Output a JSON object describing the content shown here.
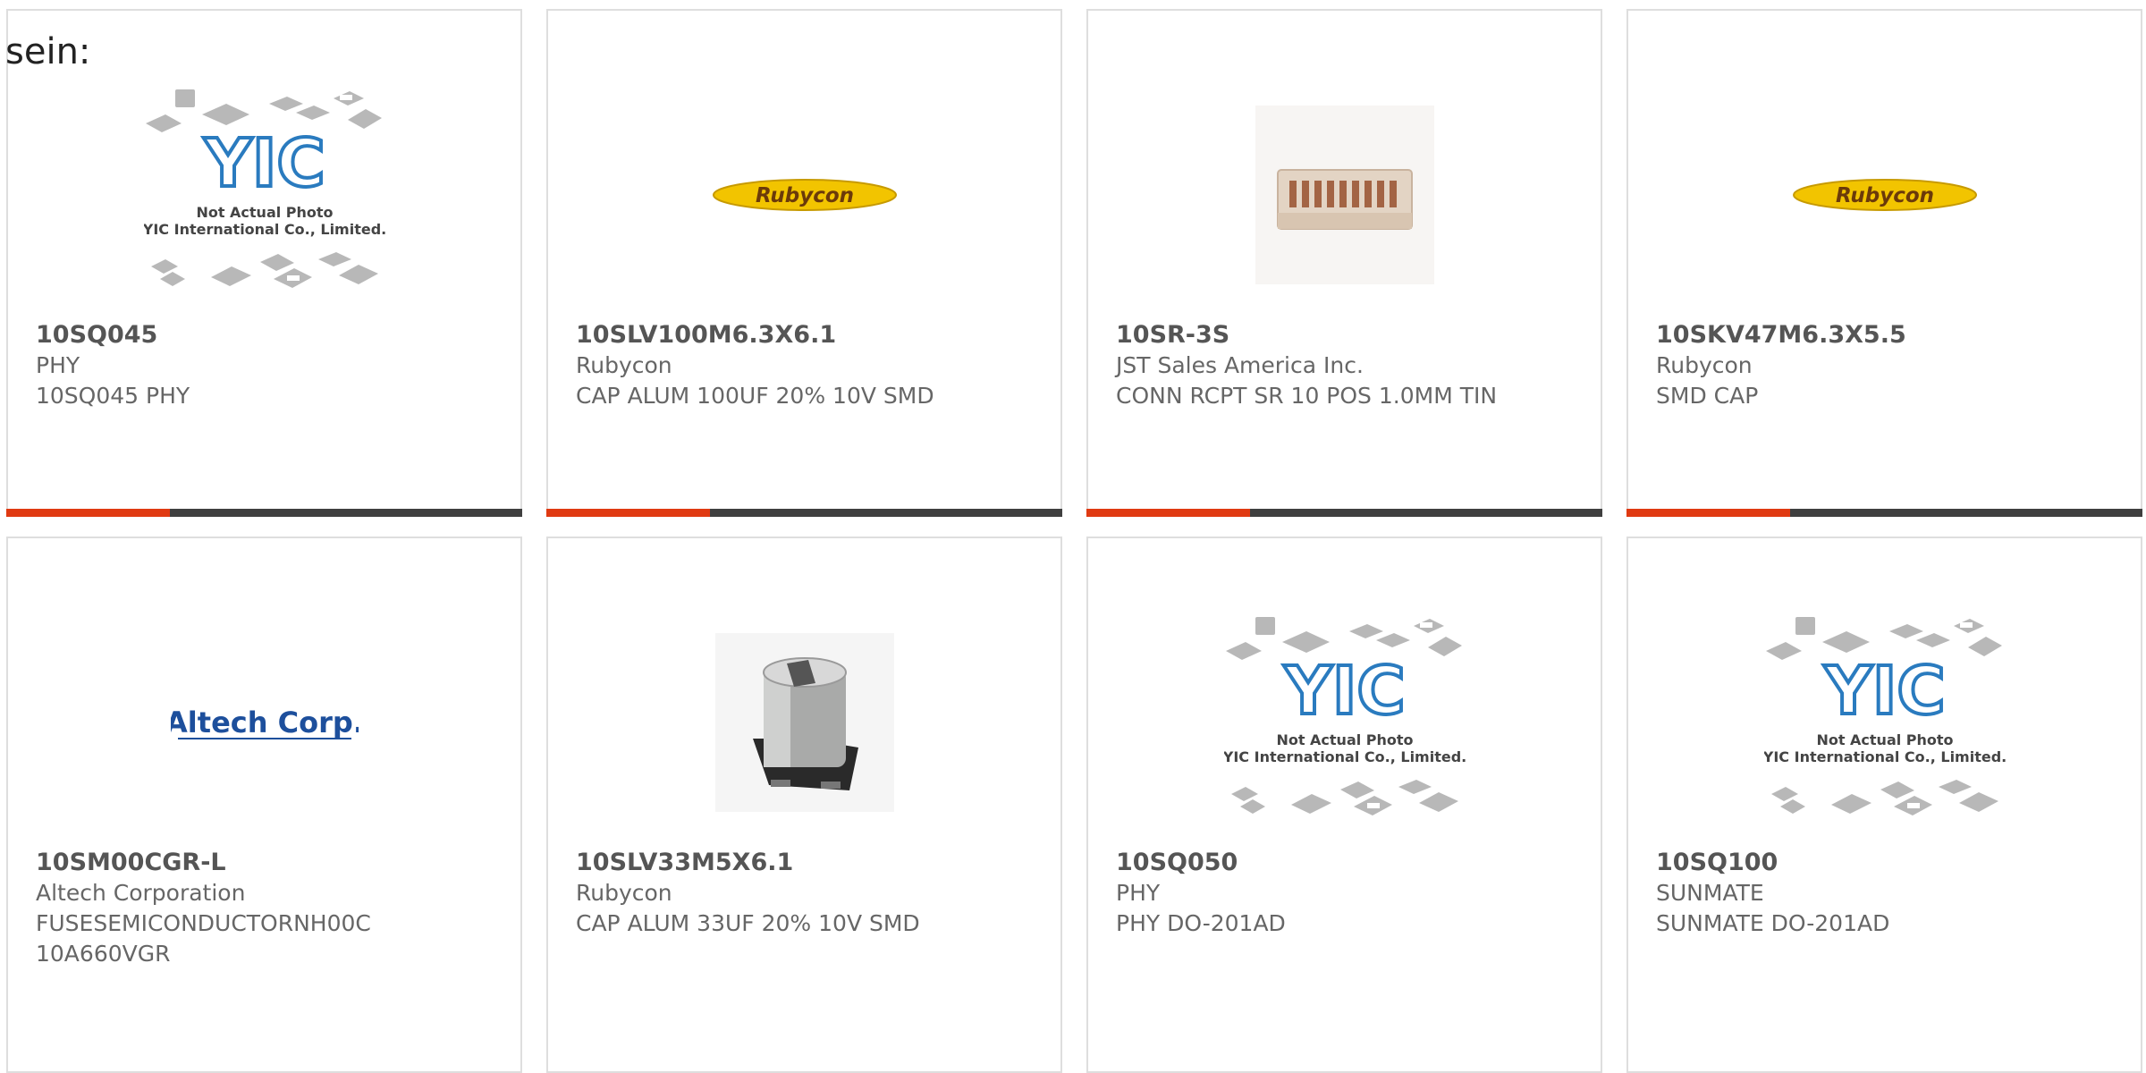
{
  "intro_text": "sein:",
  "products": [
    {
      "part": "10SQ045",
      "manufacturer": "PHY",
      "description": "10SQ045 PHY",
      "image": "yic-placeholder"
    },
    {
      "part": "10SLV100M6.3X6.1",
      "manufacturer": "Rubycon",
      "description": "CAP ALUM 100UF 20% 10V SMD",
      "image": "rubycon-logo"
    },
    {
      "part": "10SR-3S",
      "manufacturer": "JST Sales America Inc.",
      "description": "CONN RCPT SR 10 POS 1.0MM TIN",
      "image": "connector-photo"
    },
    {
      "part": "10SKV47M6.3X5.5",
      "manufacturer": "Rubycon",
      "description": "SMD CAP",
      "image": "rubycon-logo"
    },
    {
      "part": "10SM00CGR-L",
      "manufacturer": "Altech Corporation",
      "description": "FUSESEMICONDUCTORNH00C 10A660VGR",
      "image": "altech-logo"
    },
    {
      "part": "10SLV33M5X6.1",
      "manufacturer": "Rubycon",
      "description": "CAP ALUM 33UF 20% 10V SMD",
      "image": "capacitor-photo"
    },
    {
      "part": "10SQ050",
      "manufacturer": "PHY",
      "description": "PHY DO-201AD",
      "image": "yic-placeholder"
    },
    {
      "part": "10SQ100",
      "manufacturer": "SUNMATE",
      "description": "SUNMATE DO-201AD",
      "image": "yic-placeholder"
    }
  ],
  "logos": {
    "rubycon": "Rubycon",
    "altech": "Altech Corp.",
    "yic_mark": "YIC",
    "yic_line1": "Not Actual Photo",
    "yic_line2": "YIC International Co., Limited."
  },
  "colors": {
    "accent": "#e03a12",
    "bar": "#3f3f3f",
    "rubycon_yellow": "#f2c400",
    "altech_blue": "#1d4f9c",
    "yic_blue": "#2a7bbf"
  }
}
